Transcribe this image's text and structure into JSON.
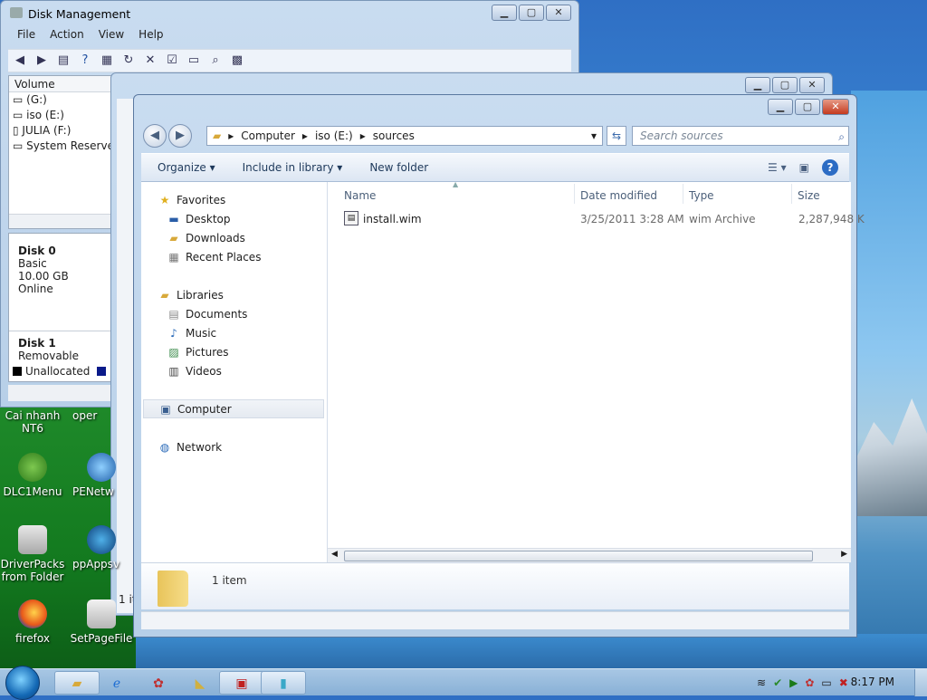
{
  "disk_management": {
    "title": "Disk Management",
    "menu": [
      "File",
      "Action",
      "View",
      "Help"
    ],
    "volume_header": "Volume",
    "volumes": [
      "(G:)",
      "iso (E:)",
      "JULIA (F:)",
      "System Reserved"
    ],
    "disk0": {
      "name": "Disk 0",
      "type": "Basic",
      "size": "10.00 GB",
      "status": "Online"
    },
    "disk1": {
      "name": "Disk 1",
      "type": "Removable"
    },
    "legend": {
      "unallocated": "Unallocated",
      "primary": "P"
    },
    "status": "1 it"
  },
  "explorer": {
    "breadcrumb": [
      "Computer",
      "iso (E:)",
      "sources"
    ],
    "search_placeholder": "Search sources",
    "commands": {
      "organize": "Organize",
      "include": "Include in library",
      "new_folder": "New folder"
    },
    "nav": {
      "favorites": "Favorites",
      "desktop": "Desktop",
      "downloads": "Downloads",
      "recent": "Recent Places",
      "libraries": "Libraries",
      "documents": "Documents",
      "music": "Music",
      "pictures": "Pictures",
      "videos": "Videos",
      "computer": "Computer",
      "network": "Network"
    },
    "columns": {
      "name": "Name",
      "date": "Date modified",
      "type": "Type",
      "size": "Size"
    },
    "files": [
      {
        "name": "install.wim",
        "date": "3/25/2011 3:28 AM",
        "type": "wim Archive",
        "size": "2,287,948 K"
      }
    ],
    "item_count": "1 item"
  },
  "desktop_icons": {
    "cai": "Cai nhanh NT6",
    "oper": "oper",
    "dlc": "DLC1Menu",
    "penet": "PENetw",
    "driver": "DriverPacks from Folder",
    "ppapps": "ppAppsv",
    "firefox": "firefox",
    "setpage": "SetPageFile"
  },
  "taskbar": {
    "clock": "8:17 PM"
  },
  "colors": {
    "accent": "#3e6dad",
    "desktop_green": "#137a1f",
    "close_red": "#c43a1e"
  }
}
